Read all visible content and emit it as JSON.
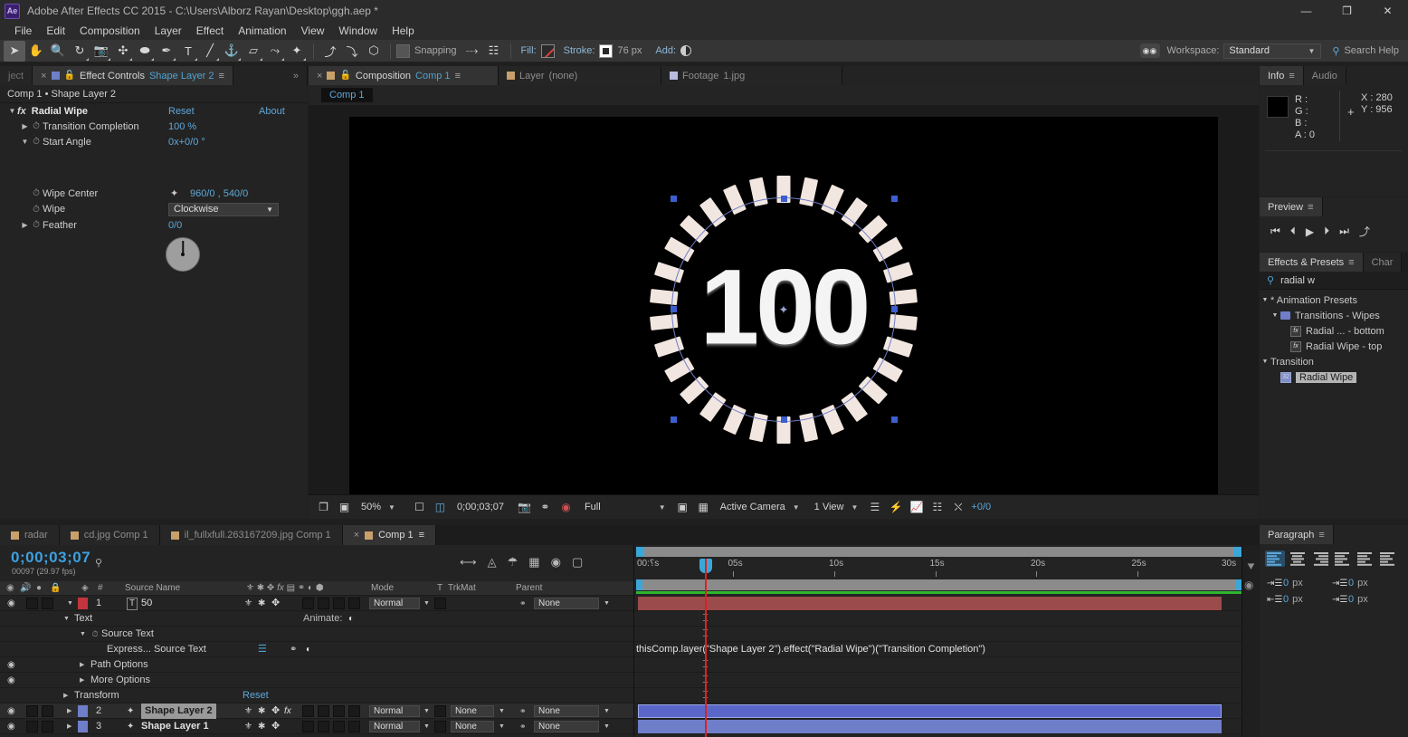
{
  "titlebar": {
    "logo": "Ae",
    "title": "Adobe After Effects CC 2015 - C:\\Users\\Alborz Rayan\\Desktop\\ggh.aep *",
    "minimize": "—",
    "maximize": "❐",
    "close": "✕"
  },
  "menu": [
    "File",
    "Edit",
    "Composition",
    "Layer",
    "Effect",
    "Animation",
    "View",
    "Window",
    "Help"
  ],
  "toolbar": {
    "tools": [
      {
        "name": "selection-tool",
        "glyph": "➤"
      },
      {
        "name": "hand-tool",
        "glyph": "✋"
      },
      {
        "name": "zoom-tool",
        "glyph": "🔍"
      },
      {
        "name": "rotation-tool",
        "glyph": "↻"
      },
      {
        "name": "camera-tool",
        "glyph": "📷"
      },
      {
        "name": "pan-behind-tool",
        "glyph": "✣"
      },
      {
        "name": "shape-tool",
        "glyph": "⬬"
      },
      {
        "name": "pen-tool",
        "glyph": "✒"
      },
      {
        "name": "type-tool",
        "glyph": "T"
      },
      {
        "name": "brush-tool",
        "glyph": "╱"
      },
      {
        "name": "clone-stamp-tool",
        "glyph": "⚓"
      },
      {
        "name": "eraser-tool",
        "glyph": "▱"
      },
      {
        "name": "roto-brush-tool",
        "glyph": "⤳"
      },
      {
        "name": "puppet-pin-tool",
        "glyph": "✦"
      }
    ],
    "snapping_tools": [
      {
        "name": "local-axis-mode-icon",
        "glyph": "⤴"
      },
      {
        "name": "world-axis-mode-icon",
        "glyph": "⤵"
      },
      {
        "name": "view-axis-mode-icon",
        "glyph": "⬡"
      }
    ],
    "snapping_label": "Snapping",
    "fill_label": "Fill:",
    "stroke_label": "Stroke:",
    "stroke_width": "76 px",
    "add_label": "Add:",
    "workspace_label": "Workspace:",
    "workspace_value": "Standard",
    "search_help": "Search Help"
  },
  "effect_controls": {
    "tab_title": "Effect Controls",
    "tab_subject": "Shape Layer 2",
    "breadcrumb": "Comp 1 • Shape Layer 2",
    "effect_name": "Radial Wipe",
    "reset": "Reset",
    "about": "About",
    "properties": [
      {
        "label": "Transition Completion",
        "value": "100 %"
      },
      {
        "label": "Start Angle",
        "value": "0x+0/0 °"
      },
      {
        "label": "Wipe Center",
        "value": "960/0 , 540/0"
      },
      {
        "label": "Wipe",
        "value": "Clockwise"
      },
      {
        "label": "Feather",
        "value": "0/0"
      }
    ]
  },
  "composition": {
    "tabs": [
      {
        "label_prefix": "Composition",
        "label_name": "Comp 1",
        "active": true
      },
      {
        "label_prefix": "Layer",
        "label_name": "(none)",
        "active": false
      },
      {
        "label_prefix": "Footage",
        "label_name": "1.jpg",
        "active": false
      }
    ],
    "subtab": "Comp 1",
    "footer": {
      "zoom": "50%",
      "timecode": "0;00;03;07",
      "resolution": "Full",
      "camera": "Active Camera",
      "views": "1 View",
      "offset": "+0/0"
    },
    "canvas": {
      "big_number": "100",
      "tick_count": 30,
      "tick_color": "#f2e6e0",
      "background": "#000000",
      "selection_color": "#3c5fd0"
    }
  },
  "info": {
    "tabs": [
      "Info",
      "Audio"
    ],
    "r": "R :",
    "g": "G :",
    "b": "B :",
    "a": "A : 0",
    "x": "X : 280",
    "y": "Y : 956"
  },
  "preview": {
    "title": "Preview",
    "buttons": [
      "⏮",
      "⏴",
      "▶",
      "⏵",
      "⏭",
      "⤴"
    ]
  },
  "effects_presets": {
    "title": "Effects & Presets",
    "other_tab": "Char",
    "search_value": "radial w",
    "tree": [
      {
        "label": "* Animation Presets",
        "depth": 0,
        "type": "group",
        "expanded": true
      },
      {
        "label": "Transitions - Wipes",
        "depth": 1,
        "type": "folder",
        "expanded": true
      },
      {
        "label": "Radial ... - bottom",
        "depth": 2,
        "type": "preset"
      },
      {
        "label": "Radial Wipe - top",
        "depth": 2,
        "type": "preset"
      },
      {
        "label": "Transition",
        "depth": 0,
        "type": "group",
        "expanded": true
      },
      {
        "label": "Radial Wipe",
        "depth": 1,
        "type": "effect",
        "selected": true
      }
    ]
  },
  "paragraph": {
    "title": "Paragraph",
    "align_buttons": [
      "align-left",
      "align-center",
      "align-right",
      "justify-last-left",
      "justify-last-center",
      "justify-last-right"
    ],
    "fields": [
      {
        "name": "indent-left",
        "value": "0",
        "unit": "px"
      },
      {
        "name": "space-before",
        "value": "0",
        "unit": "px"
      },
      {
        "name": "indent-right",
        "value": "0",
        "unit": "px"
      },
      {
        "name": "space-after",
        "value": "0",
        "unit": "px"
      }
    ]
  },
  "timeline": {
    "tabs": [
      {
        "label": "radar",
        "active": false
      },
      {
        "label": "cd.jpg Comp 1",
        "active": false
      },
      {
        "label": "il_fullxfull.263167209.jpg Comp 1",
        "active": false
      },
      {
        "label": "Comp 1",
        "active": true
      }
    ],
    "current_time": "0;00;03;07",
    "frame_info": "00097 (29.97 fps)",
    "columns": [
      "#",
      "Source Name",
      "Mode",
      "T",
      "TrkMat",
      "Parent"
    ],
    "ruler_ticks": [
      "؟:00s",
      "05s",
      "10s",
      "15s",
      "20s",
      "25s",
      "30s"
    ],
    "expression": "thisComp.layer(\"Shape Layer 2\").effect(\"Radial Wipe\")(\"Transition Completion\")",
    "rows": [
      {
        "kind": "layer",
        "num": "1",
        "name": "50",
        "mode": "Normal",
        "parent": "None",
        "color": "#c4343c",
        "selected": false,
        "bar_color": "#9b4b4b",
        "type_icon": "T"
      },
      {
        "kind": "prop",
        "indent": 3,
        "label": "Text",
        "extra": "Animate:"
      },
      {
        "kind": "prop",
        "indent": 4,
        "label": "Source Text"
      },
      {
        "kind": "prop",
        "indent": 5,
        "label": "Express... Source Text"
      },
      {
        "kind": "prop",
        "indent": 4,
        "label": "Path Options"
      },
      {
        "kind": "prop",
        "indent": 4,
        "label": "More Options"
      },
      {
        "kind": "prop",
        "indent": 3,
        "label": "Transform",
        "reset": "Reset"
      },
      {
        "kind": "layer",
        "num": "2",
        "name": "Shape Layer 2",
        "mode": "Normal",
        "trkmat": "None",
        "parent": "None",
        "color": "#6f7ec9",
        "selected": true,
        "bar_color": "#5b67c8",
        "has_fx": true
      },
      {
        "kind": "layer",
        "num": "3",
        "name": "Shape Layer 1",
        "mode": "Normal",
        "trkmat": "None",
        "parent": "None",
        "color": "#6f7ec9",
        "selected": false,
        "bar_color": "#6f7ec9"
      }
    ]
  }
}
